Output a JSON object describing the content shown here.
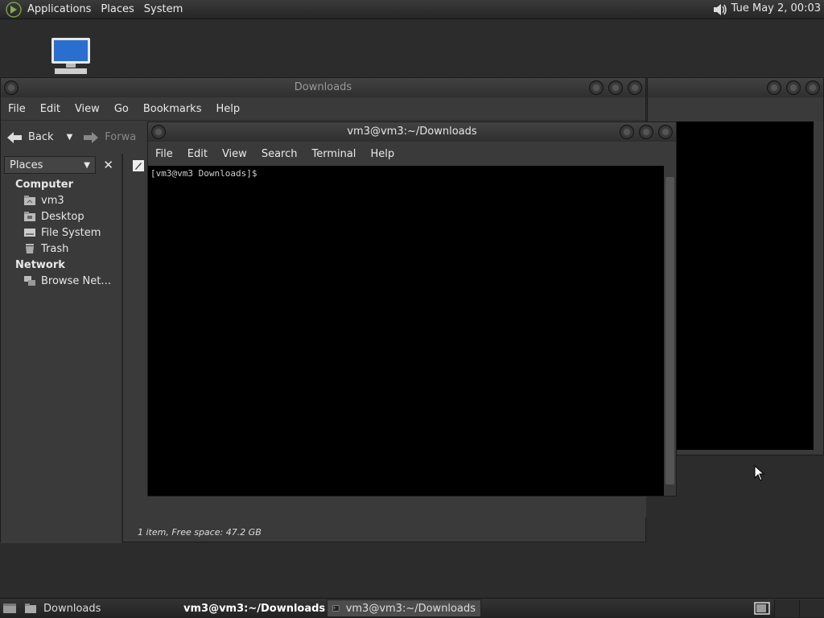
{
  "top_panel": {
    "menus": [
      "Applications",
      "Places",
      "System"
    ],
    "clock": "Tue May  2, 00:03"
  },
  "fm_window": {
    "title": "Downloads",
    "menu": [
      "File",
      "Edit",
      "View",
      "Go",
      "Bookmarks",
      "Help"
    ],
    "toolbar": {
      "back": "Back",
      "forward": "Forwa"
    },
    "sidepane": {
      "header": "Places",
      "sections": [
        {
          "title": "Computer",
          "items": [
            {
              "label": "vm3",
              "icon": "home-folder-icon"
            },
            {
              "label": "Desktop",
              "icon": "desktop-folder-icon"
            },
            {
              "label": "File System",
              "icon": "drive-icon"
            },
            {
              "label": "Trash",
              "icon": "trash-icon"
            }
          ]
        },
        {
          "title": "Network",
          "items": [
            {
              "label": "Browse Net…",
              "icon": "network-icon"
            }
          ]
        }
      ]
    },
    "status": "1 item, Free space: 47.2 GB"
  },
  "terminal": {
    "title": "vm3@vm3:~/Downloads",
    "menu": [
      "File",
      "Edit",
      "View",
      "Search",
      "Terminal",
      "Help"
    ],
    "prompt": "[vm3@vm3 Downloads]$"
  },
  "taskbar": {
    "tasks": [
      {
        "label": "Downloads",
        "state": "normal"
      },
      {
        "label": "vm3@vm3:~/Downloads",
        "state": "active"
      },
      {
        "label": "vm3@vm3:~/Downloads",
        "state": "pressed"
      }
    ]
  }
}
